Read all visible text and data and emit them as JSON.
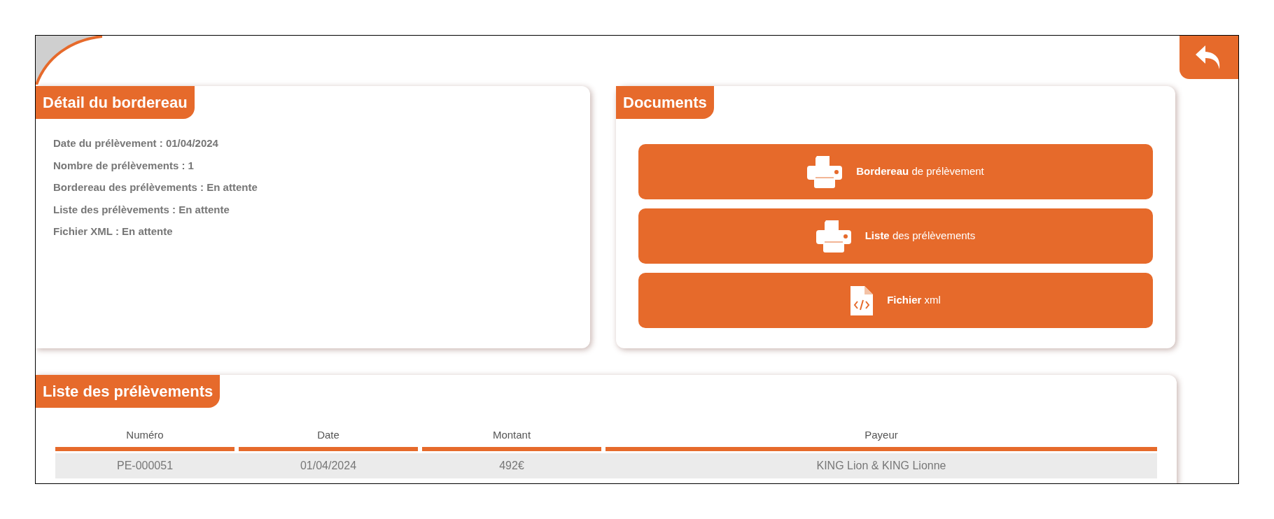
{
  "detail": {
    "title": "Détail du bordereau",
    "lines": [
      "Date du prélèvement : 01/04/2024",
      "Nombre de prélèvements : 1",
      "Bordereau des prélèvements : En attente",
      "Liste des prélèvements : En attente",
      "Fichier XML : En attente"
    ]
  },
  "documents": {
    "title": "Documents",
    "buttons": [
      {
        "kind": "print",
        "label": "**Bordereau** de prélèvement"
      },
      {
        "kind": "print",
        "label": "**Liste** des prélèvements"
      },
      {
        "kind": "xml",
        "label": "**Fichier** xml"
      }
    ]
  },
  "list": {
    "title": "Liste des prélèvements",
    "columns": [
      "Numéro",
      "Date",
      "Montant",
      "Payeur"
    ],
    "rows": [
      [
        "PE-000051",
        "01/04/2024",
        "492€",
        "KING Lion & KING Lionne"
      ]
    ]
  }
}
